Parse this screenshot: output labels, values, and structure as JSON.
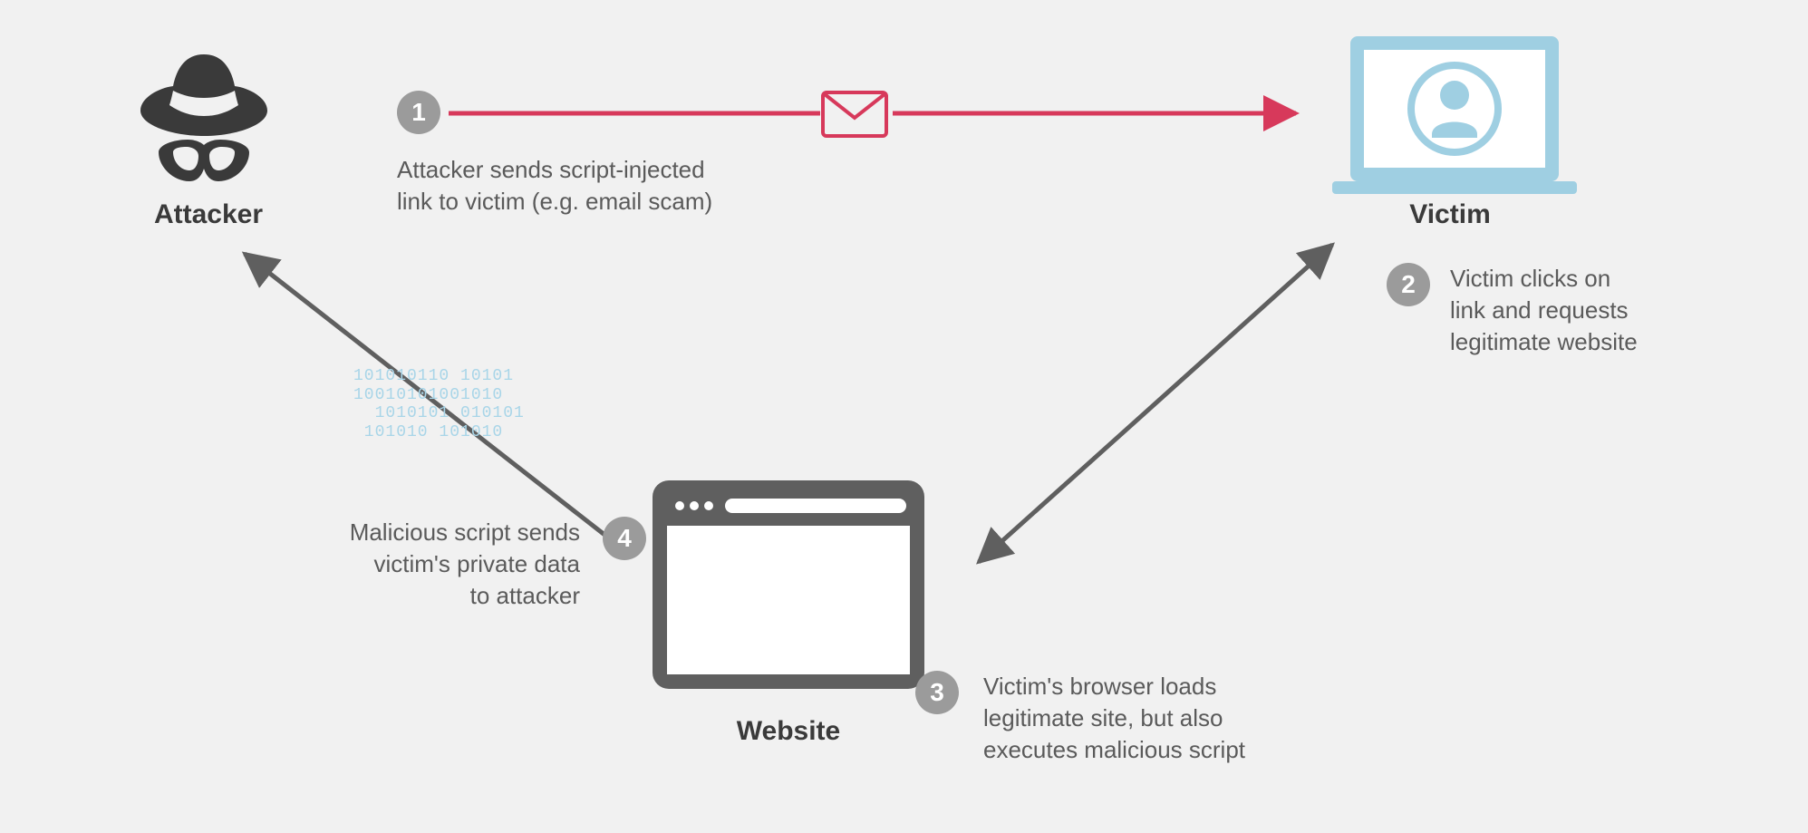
{
  "nodes": {
    "attacker": {
      "label": "Attacker"
    },
    "victim": {
      "label": "Victim"
    },
    "website": {
      "label": "Website"
    }
  },
  "steps": {
    "s1": {
      "num": "1",
      "text": "Attacker sends script-injected\nlink to victim (e.g. email scam)"
    },
    "s2": {
      "num": "2",
      "text": "Victim clicks on\nlink and requests\nlegitimate website"
    },
    "s3": {
      "num": "3",
      "text": "Victim's browser loads\nlegitimate site, but also\nexecutes malicious script"
    },
    "s4": {
      "num": "4",
      "text": "Malicious script sends\nvictim's private data\nto attacker"
    }
  },
  "decor": {
    "binary": "101010110 10101\n10010101001010\n  1010101 010101\n 101010 101010"
  },
  "colors": {
    "gray": "#5f5f5f",
    "badge": "#9b9b9b",
    "red": "#d7395b",
    "light": "#a9d4e6",
    "dark": "#3a3a3a"
  }
}
